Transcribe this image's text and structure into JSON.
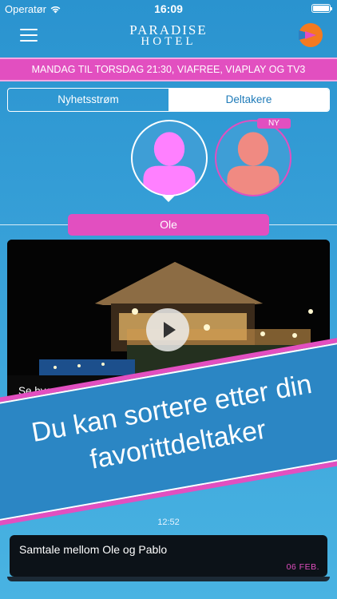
{
  "status_bar": {
    "carrier": "Operatør",
    "time": "16:09",
    "battery_level": 1.0
  },
  "header": {
    "logo_line1": "PARADISE",
    "logo_line2": "HOTEL",
    "menu_icon": "hamburger-icon",
    "app_icon": "play-logo-icon"
  },
  "banner": {
    "text": "MANDAG TIL TORSDAG 21:30, VIAFREE, VIAPLAY OG TV3"
  },
  "tabs": [
    {
      "label": "Nyhetsstrøm",
      "active": false
    },
    {
      "label": "Deltakere",
      "active": true
    }
  ],
  "participants": [
    {
      "selected": true,
      "avatar_color": "#ff80ff"
    },
    {
      "selected": false,
      "avatar_color": "#f08a82",
      "badge": "NY"
    }
  ],
  "selected_name": "Ole",
  "video": {
    "title": "Se hvem som sjekker inn..."
  },
  "promo": {
    "line1": "Du kan sortere etter din",
    "line2": "favorittdeltaker"
  },
  "feed": {
    "time": "12:52",
    "message_title": "Samtale mellom Ole og Pablo",
    "message_date": "06 FEB."
  },
  "colors": {
    "accent_pink": "#e24fc0",
    "background_blue": "#3aa3da",
    "tab_text_blue": "#1f7bb9"
  }
}
